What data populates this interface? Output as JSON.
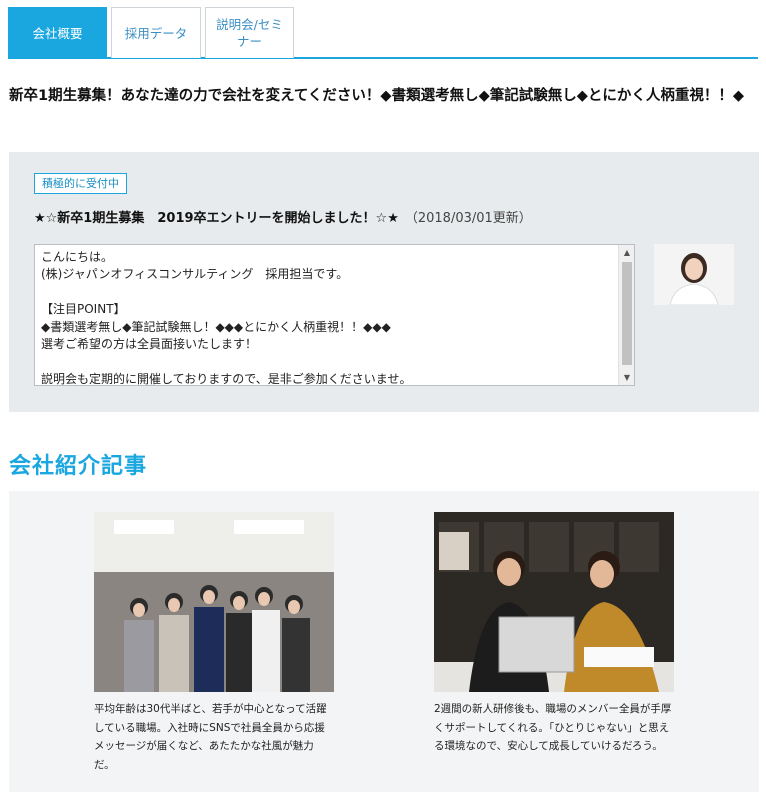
{
  "tabs": [
    {
      "label": "会社概要",
      "active": true
    },
    {
      "label": "採用データ",
      "active": false
    },
    {
      "label": "説明会/セミナー",
      "active": false
    }
  ],
  "headline": "新卒1期生募集！あなた達の力で会社を変えてください！◆書類選考無し◆筆記試験無し◆とにかく人柄重視！！◆",
  "recruit": {
    "badge": "積極的に受付中",
    "title": "★☆新卒1期生募集　2019卒エントリーを開始しました！☆★",
    "updated": "（2018/03/01更新）",
    "message": "こんにちは。\n(株)ジャパンオフィスコンサルティング　採用担当です。\n\n【注目POINT】\n◆書類選考無し◆筆記試験無し！◆◆◆とにかく人柄重視！！◆◆◆\n選考ご希望の方は全員面接いたします！\n\n説明会も定期的に開催しておりますので、是非ご参加くださいませ。"
  },
  "section_title": "会社紹介記事",
  "articles": [
    {
      "caption": "平均年齢は30代半ばと、若手が中心となって活躍している職場。入社時にSNSで社員全員から応援メッセージが届くなど、あたたかな社風が魅力だ。"
    },
    {
      "caption": "2週間の新人研修後も、職場のメンバー全員が手厚くサポートしてくれる。「ひとりじゃない」と思える環境なので、安心して成長していけるだろう。"
    }
  ],
  "colors": {
    "accent": "#1aa7e0",
    "panel": "#e8ebed"
  }
}
